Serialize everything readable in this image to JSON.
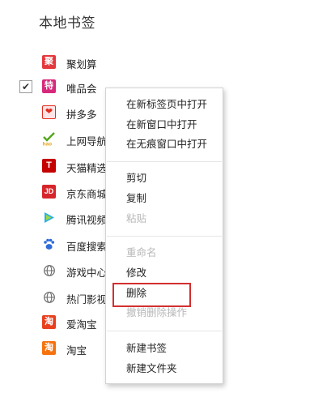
{
  "page": {
    "title": "本地书签"
  },
  "bookmarks": [
    {
      "label": "聚划算",
      "icon": "juhuasuan-icon",
      "glyph": "聚",
      "color": "#e4393c",
      "checked": false
    },
    {
      "label": "唯品会",
      "icon": "vip-icon",
      "glyph": "特",
      "color": "#d6297b",
      "checked": true
    },
    {
      "label": "拼多多",
      "icon": "pinduoduo-icon",
      "glyph": "❤",
      "color": "#e22e1f",
      "checked": false
    },
    {
      "label": "上网导航",
      "icon": "hao-icon",
      "glyph": "✔",
      "color": "#54a51c",
      "checked": false
    },
    {
      "label": "天猫精选",
      "icon": "tmall-icon",
      "glyph": "T",
      "color": "#c40000",
      "checked": false
    },
    {
      "label": "京东商城",
      "icon": "jd-icon",
      "glyph": "JD",
      "color": "#d6262b",
      "checked": false
    },
    {
      "label": "腾讯视频",
      "icon": "tencent-video-icon",
      "glyph": "▶",
      "color": "#2ab0e8",
      "checked": false
    },
    {
      "label": "百度搜索",
      "icon": "baidu-paw-icon",
      "glyph": "🐾",
      "color": "#2f6bd8",
      "checked": false
    },
    {
      "label": "游戏中心",
      "icon": "globe-icon",
      "glyph": "",
      "color": "#666666",
      "checked": false
    },
    {
      "label": "热门影视",
      "icon": "globe-icon",
      "glyph": "",
      "color": "#666666",
      "checked": false
    },
    {
      "label": "爱淘宝",
      "icon": "aitaobao-icon",
      "glyph": "淘",
      "color": "#e8401f",
      "checked": false
    },
    {
      "label": "淘宝",
      "icon": "taobao-icon",
      "glyph": "淘",
      "color": "#f5730f",
      "checked": false
    }
  ],
  "menu": {
    "items": [
      {
        "label": "在新标签页中打开",
        "disabled": false,
        "name": "menu-open-new-tab"
      },
      {
        "label": "在新窗口中打开",
        "disabled": false,
        "name": "menu-open-new-window"
      },
      {
        "label": "在无痕窗口中打开",
        "disabled": false,
        "name": "menu-open-incognito"
      },
      {
        "label": "剪切",
        "disabled": false,
        "name": "menu-cut"
      },
      {
        "label": "复制",
        "disabled": false,
        "name": "menu-copy"
      },
      {
        "label": "粘贴",
        "disabled": true,
        "name": "menu-paste"
      },
      {
        "label": "重命名",
        "disabled": true,
        "name": "menu-rename"
      },
      {
        "label": "修改",
        "disabled": false,
        "name": "menu-edit"
      },
      {
        "label": "删除",
        "disabled": false,
        "name": "menu-delete"
      },
      {
        "label": "撤销删除操作",
        "disabled": true,
        "name": "menu-undo-delete"
      },
      {
        "label": "新建书签",
        "disabled": false,
        "name": "menu-new-bookmark"
      },
      {
        "label": "新建文件夹",
        "disabled": false,
        "name": "menu-new-folder"
      }
    ]
  },
  "colors": {
    "highlight_border": "#d32f2f",
    "separator": "#e6e6e6",
    "disabled_text": "#b8b8b8"
  }
}
